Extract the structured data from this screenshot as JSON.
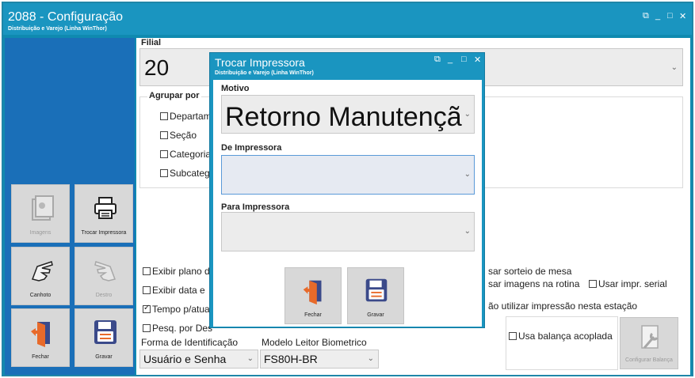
{
  "window": {
    "title": "2088 - Configuração",
    "subtitle": "Distribuição e Varejo (Linha WinThor)",
    "controls": [
      "⧉",
      "_",
      "□",
      "✕"
    ]
  },
  "sidebar": {
    "buttons": [
      {
        "label": "Imagens",
        "icon": "images-icon",
        "enabled": false
      },
      {
        "label": "Trocar Impressora",
        "icon": "printer-icon",
        "enabled": true
      },
      {
        "label": "Canhoto",
        "icon": "left-hand-icon",
        "enabled": true
      },
      {
        "label": "Destro",
        "icon": "right-hand-icon",
        "enabled": false
      },
      {
        "label": "Fechar",
        "icon": "exit-door-icon",
        "enabled": true
      },
      {
        "label": "Gravar",
        "icon": "floppy-disk-icon",
        "enabled": true
      }
    ]
  },
  "main": {
    "filial_label": "Filial",
    "filial_value": "20",
    "agrupar_label": "Agrupar por",
    "agrupar_options": [
      {
        "label": "Departam",
        "checked": false
      },
      {
        "label": "Seção",
        "checked": false
      },
      {
        "label": "Categoria",
        "checked": false
      },
      {
        "label": "Subcateg",
        "checked": false
      }
    ],
    "left_checks": [
      {
        "label": "Exibir plano d",
        "checked": false
      },
      {
        "label": "Exibir data e",
        "checked": false
      },
      {
        "label": "Tempo p/atua",
        "checked": true
      },
      {
        "label": "Pesq. por Des",
        "checked": false
      }
    ],
    "right_checks": {
      "sorteio": "sar sorteio de mesa",
      "imagens": "sar imagens na rotina",
      "impr_serial": "Usar impr. serial",
      "nao_utilizar": "ão utilizar impressão nesta estação"
    },
    "balanca_label": "Usa balança acoplada",
    "configurar_balanca_label": "Configurar Balança",
    "forma_ident_label": "Forma de Identificação",
    "forma_ident_value": "Usuário e Senha",
    "modelo_leitor_label": "Modelo Leitor Biometrico",
    "modelo_leitor_value": "FS80H-BR"
  },
  "dialog": {
    "title": "Trocar Impressora",
    "subtitle": "Distribuição e Varejo (Linha WinThor)",
    "controls": [
      "⧉",
      "_",
      "□",
      "✕"
    ],
    "motivo_label": "Motivo",
    "motivo_value": "Retorno Manutençã",
    "de_label": "De Impressora",
    "de_value": "",
    "para_label": "Para Impressora",
    "para_value": "",
    "fechar_label": "Fechar",
    "gravar_label": "Gravar"
  },
  "colors": {
    "titlebar": "#1a95c0",
    "sidebar": "#1a6fb8",
    "button_bg": "#d8d8d8",
    "floppy_accent": "#e86a2a",
    "floppy_body": "#3b4a8a"
  }
}
